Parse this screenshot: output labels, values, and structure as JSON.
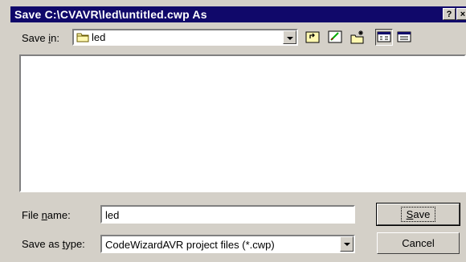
{
  "window": {
    "title": "Save C:\\CVAVR\\led\\untitled.cwp As",
    "help_glyph": "?",
    "close_glyph": "×"
  },
  "save_in": {
    "label_pre": "Save ",
    "label_key": "i",
    "label_post": "n:",
    "value": "led",
    "icon": "folder-icon"
  },
  "toolbar": {
    "buttons": [
      "up-one-level-icon",
      "desktop-icon",
      "new-folder-icon",
      "list-view-icon",
      "details-view-icon"
    ]
  },
  "file_name": {
    "label_pre": "File ",
    "label_key": "n",
    "label_post": "ame:",
    "value": "led"
  },
  "save_as_type": {
    "label_pre": "Save as ",
    "label_key": "t",
    "label_post": "ype:",
    "value": "CodeWizardAVR project files (*.cwp)"
  },
  "buttons": {
    "save_key": "S",
    "save_rest": "ave",
    "cancel": "Cancel"
  },
  "colors": {
    "titlebar": "#10086a",
    "face": "#d4d0c8"
  }
}
